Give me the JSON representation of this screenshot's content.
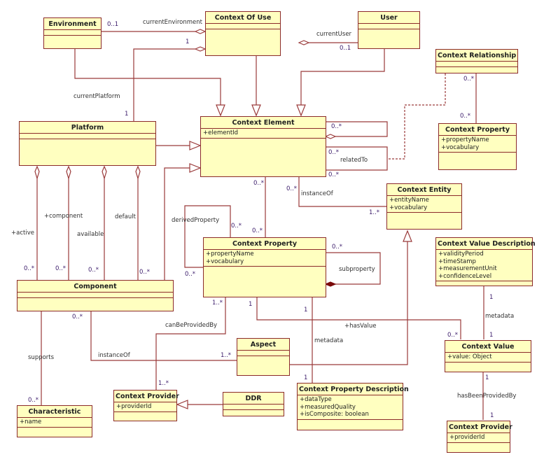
{
  "diagram": {
    "type": "UML class diagram",
    "classes": {
      "environment": {
        "name": "Environment",
        "attributes": []
      },
      "context_of_use": {
        "name": "Context Of Use",
        "attributes": []
      },
      "user": {
        "name": "User",
        "attributes": []
      },
      "context_relationship": {
        "name": "Context Relationship",
        "attributes": []
      },
      "context_property_right": {
        "name": "Context Property",
        "attributes": [
          "+propertyName",
          "+vocabulary"
        ]
      },
      "platform": {
        "name": "Platform",
        "attributes": []
      },
      "context_element": {
        "name": "Context Element",
        "attributes": [
          "+elementId"
        ]
      },
      "context_entity": {
        "name": "Context Entity",
        "attributes": [
          "+entityName",
          "+vocabulary"
        ]
      },
      "context_property": {
        "name": "Context Property",
        "attributes": [
          "+propertyName",
          "+vocabulary"
        ]
      },
      "context_value_description": {
        "name": "Context Value Description",
        "attributes": [
          "+validityPeriod",
          "+timeStamp",
          "+measurementUnit",
          "+confidenceLevel"
        ]
      },
      "component": {
        "name": "Component",
        "attributes": []
      },
      "aspect": {
        "name": "Aspect",
        "attributes": []
      },
      "context_value": {
        "name": "Context Value",
        "attributes": [
          "+value: Object"
        ]
      },
      "characteristic": {
        "name": "Characteristic",
        "attributes": [
          "+name"
        ]
      },
      "context_provider": {
        "name": "Context Provider",
        "attributes": [
          "+providerId"
        ]
      },
      "ddr": {
        "name": "DDR",
        "attributes": []
      },
      "context_property_description": {
        "name": "Context Property Description",
        "attributes": [
          "+dataType",
          "+measuredQuality",
          "+isComposite: boolean"
        ]
      },
      "context_provider_right": {
        "name": "Context Provider",
        "attributes": [
          "+providerId"
        ]
      }
    },
    "labels": {
      "current_environment": "currentEnvironment",
      "current_user": "currentUser",
      "current_platform": "currentPlatform",
      "related_to": "relatedTo",
      "instance_of_top": "instanceOf",
      "derived_property": "derivedProperty",
      "subproperty": "subproperty",
      "active": "+active",
      "component": "+component",
      "available": "available",
      "default": "default",
      "can_be_provided_by": "canBeProvidedBy",
      "has_value": "+hasValue",
      "metadata_left": "metadata",
      "metadata_right": "metadata",
      "supports": "supports",
      "instance_of_bottom": "instanceOf",
      "has_been_provided_by": "hasBeenProvidedBy"
    },
    "multiplicities": {
      "env_cou": "0..1",
      "platform_cou": "1",
      "platform_end": "1",
      "user_cou": "0..1",
      "crel_top": "0..*",
      "crel_bottom": "0..*",
      "ce_self_agg": "0..*",
      "ce_related_a": "0..*",
      "ce_related_b": "0..*",
      "ce_bottom": "0..*",
      "ce_instance": "0..*",
      "entity_instance": "1..*",
      "derived_a": "0..*",
      "derived_b": "0..*",
      "cp_top": "0..*",
      "cp_sub": "0..*",
      "active": "0..*",
      "component": "0..*",
      "available": "0..*",
      "default": "0..*",
      "comp_instance": "0..*",
      "cp_provided": "1..*",
      "cp_value": "1",
      "cp_desc_top": "1",
      "cp_desc_bottom": "1",
      "cv_has_value": "0..*",
      "cvd_bottom": "1",
      "cv_top": "1",
      "cv_bottom": "1",
      "provider_right_top": "1",
      "aspect_instance": "1..*",
      "provider_top": "1..*",
      "characteristic_top": "0..*"
    }
  }
}
